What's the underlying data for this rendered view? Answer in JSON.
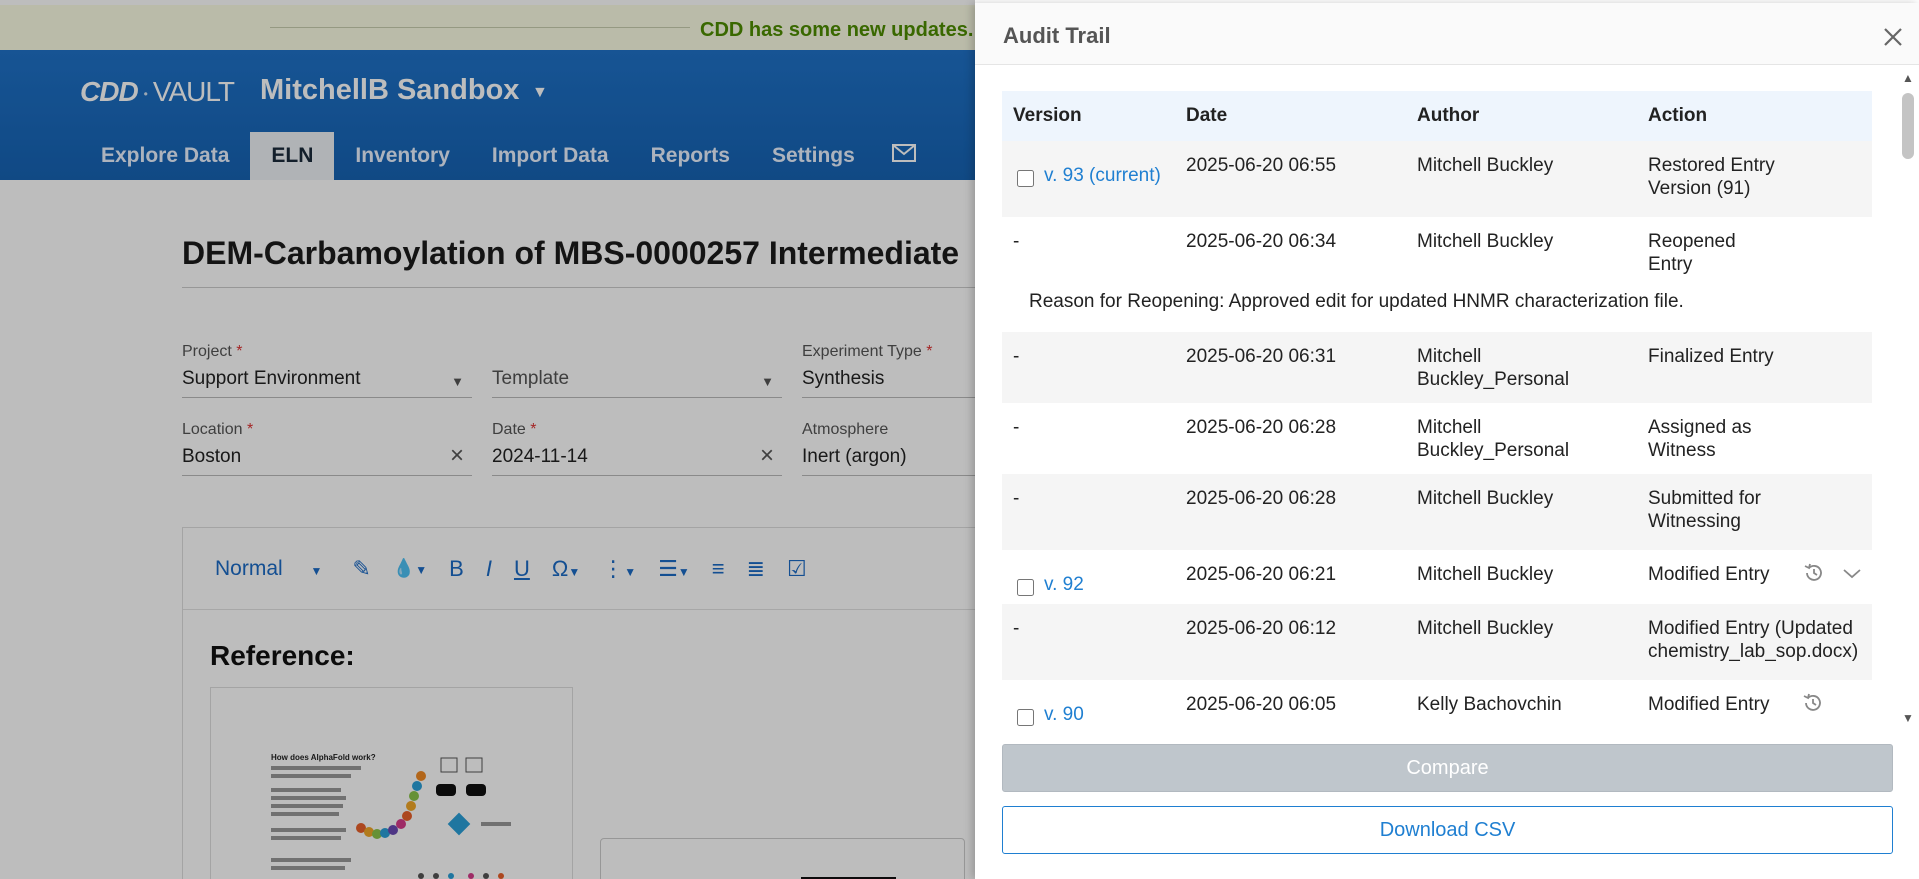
{
  "update_banner": "CDD has some new updates.",
  "header": {
    "logo_prefix": "CDD",
    "logo_suffix": "VAULT",
    "vault_name": "MitchellB Sandbox",
    "tabs": [
      "Explore Data",
      "ELN",
      "Inventory",
      "Import Data",
      "Reports",
      "Settings"
    ],
    "active_tab": "ELN"
  },
  "entry": {
    "title": "DEM-Carbamoylation of MBS-0000257 Intermediate",
    "fields": {
      "project_label": "Project",
      "project_value": "Support Environment",
      "template_label": "Template",
      "experiment_type_label": "Experiment Type",
      "experiment_type_value": "Synthesis",
      "location_label": "Location",
      "location_value": "Boston",
      "date_label": "Date",
      "date_value": "2024-11-14",
      "atmosphere_label": "Atmosphere",
      "atmosphere_value": "Inert (argon)",
      "required_mark": "*"
    },
    "toolbar": {
      "text_style": "Normal"
    },
    "reference_heading": "Reference:",
    "thumbnail_heading": "How does AlphaFold work?"
  },
  "audit": {
    "title": "Audit Trail",
    "columns": [
      "Version",
      "Date",
      "Author",
      "Action"
    ],
    "rows": [
      {
        "version": "v. 93 (current)",
        "checkbox": true,
        "date": "2025-06-20 06:55",
        "author": "Mitchell Buckley",
        "action": "Restored Entry Version (91)",
        "icons": []
      },
      {
        "version": "-",
        "checkbox": false,
        "date": "2025-06-20 06:34",
        "author": "Mitchell Buckley",
        "action": "Reopened Entry",
        "icons": []
      },
      {
        "version": "-",
        "checkbox": false,
        "date": "2025-06-20 06:31",
        "author": "Mitchell Buckley_Personal",
        "action": "Finalized Entry",
        "icons": []
      },
      {
        "version": "-",
        "checkbox": false,
        "date": "2025-06-20 06:28",
        "author": "Mitchell Buckley_Personal",
        "action": "Assigned as Witness",
        "icons": []
      },
      {
        "version": "-",
        "checkbox": false,
        "date": "2025-06-20 06:28",
        "author": "Mitchell Buckley",
        "action": "Submitted for Witnessing",
        "icons": []
      },
      {
        "version": "v. 92",
        "checkbox": true,
        "date": "2025-06-20 06:21",
        "author": "Mitchell Buckley",
        "action": "Modified Entry",
        "icons": [
          "history",
          "chevron"
        ]
      },
      {
        "version": "-",
        "checkbox": false,
        "date": "2025-06-20 06:12",
        "author": "Mitchell Buckley",
        "action": "Modified Entry (Updated chemistry_lab_sop.docx)",
        "icons": []
      },
      {
        "version": "v. 90",
        "checkbox": true,
        "date": "2025-06-20 06:05",
        "author": "Kelly Bachovchin",
        "action": "Modified Entry",
        "icons": [
          "history"
        ]
      }
    ],
    "reason_text": "Reason for Reopening: Approved edit for updated HNMR characterization file.",
    "compare_label": "Compare",
    "download_label": "Download CSV",
    "colors": {
      "link": "#1f7fd1",
      "header_bg": "#eef5fd",
      "zebra": "#f5f5f5"
    }
  }
}
